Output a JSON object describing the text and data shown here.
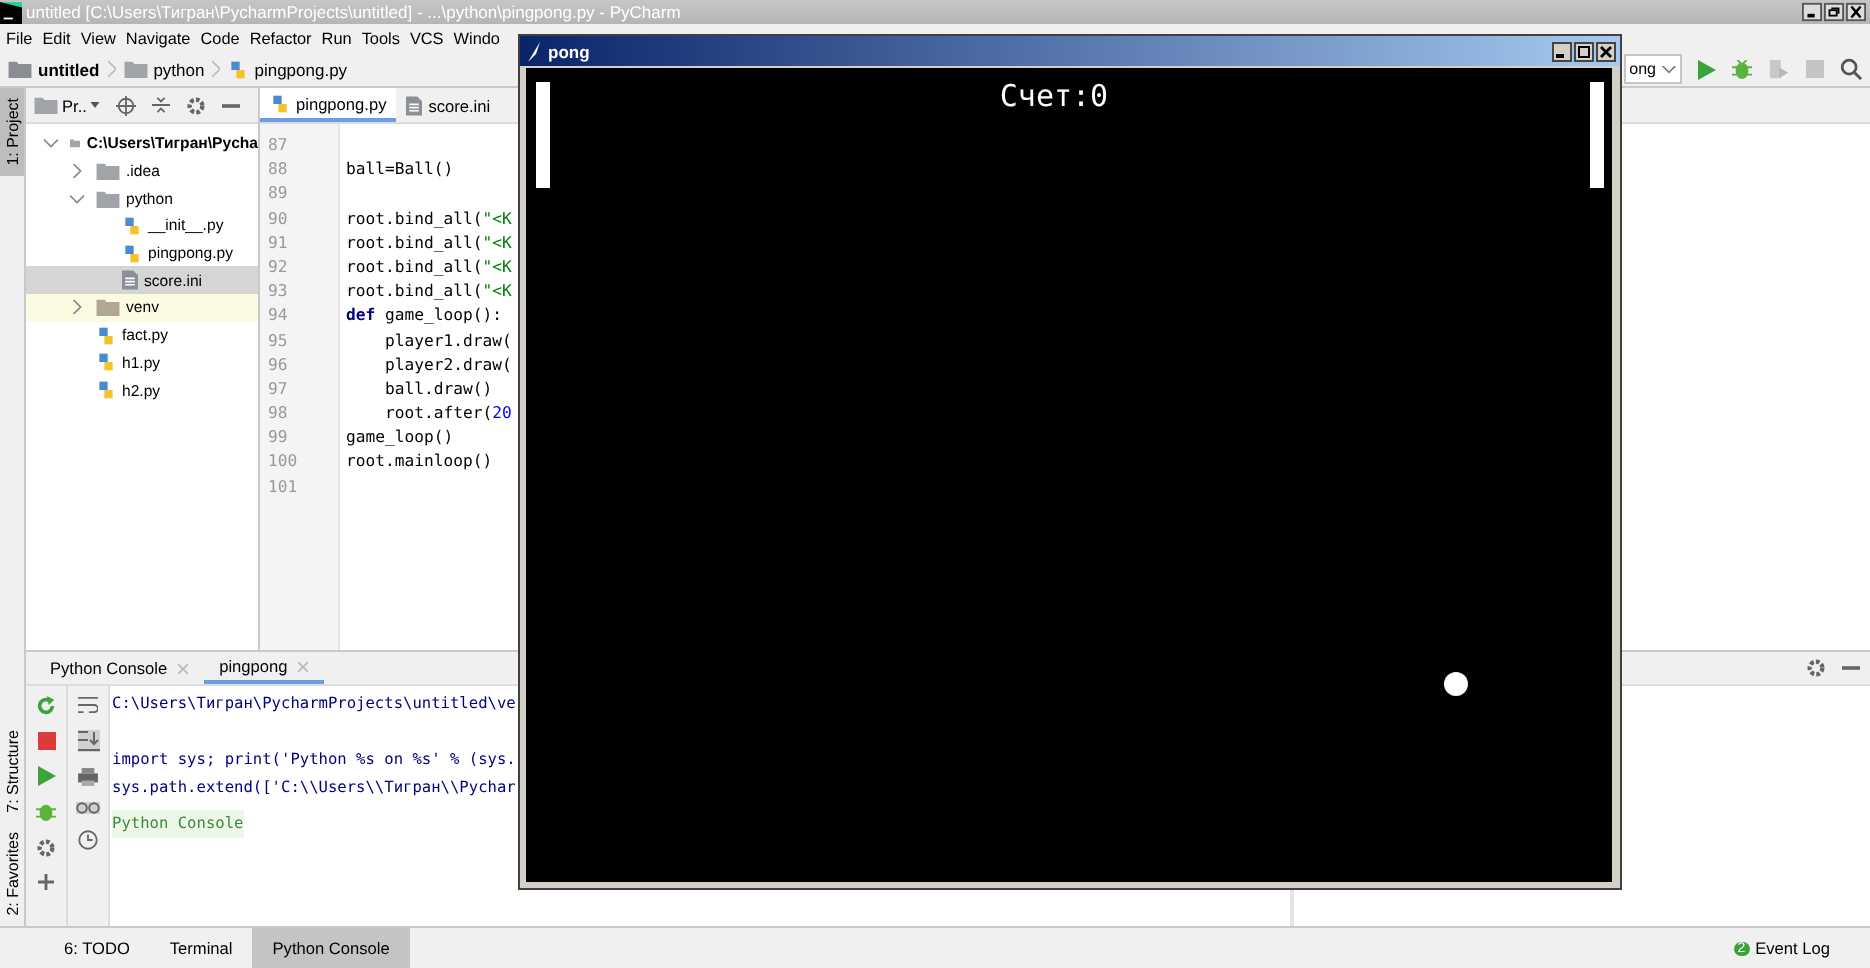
{
  "window": {
    "title": "untitled [C:\\Users\\Тигран\\PycharmProjects\\untitled] - ...\\python\\pingpong.py - PyCharm"
  },
  "menu": [
    "File",
    "Edit",
    "View",
    "Navigate",
    "Code",
    "Refactor",
    "Run",
    "Tools",
    "VCS",
    "Windo"
  ],
  "breadcrumbs": [
    {
      "label": "untitled",
      "kind": "project"
    },
    {
      "label": "python",
      "kind": "folder"
    },
    {
      "label": "pingpong.py",
      "kind": "python"
    }
  ],
  "run_config": {
    "label": "ong"
  },
  "left_stripe_top": [
    {
      "label": "1: Project",
      "selected": true
    }
  ],
  "left_stripe_bottom": [
    {
      "label": "7: Structure",
      "selected": false
    },
    {
      "label": "2: Favorites",
      "selected": false
    }
  ],
  "project_panel": {
    "title": "Pr.."
  },
  "tree": [
    {
      "label": "C:\\Users\\Тигран\\Pycha",
      "kind": "folder",
      "expanded": true,
      "selected": false,
      "children": [
        {
          "label": ".idea",
          "kind": "folder",
          "expanded": false,
          "selected": false
        },
        {
          "label": "python",
          "kind": "folder",
          "expanded": true,
          "selected": false,
          "children": [
            {
              "label": "__init__.py",
              "kind": "python",
              "selected": false
            },
            {
              "label": "pingpong.py",
              "kind": "python",
              "selected": false
            },
            {
              "label": "score.ini",
              "kind": "ini",
              "selected": true
            }
          ]
        },
        {
          "label": "venv",
          "kind": "excluded_folder",
          "expanded": false,
          "selected": false
        },
        {
          "label": "fact.py",
          "kind": "python",
          "selected": false
        },
        {
          "label": "h1.py",
          "kind": "python",
          "selected": false
        },
        {
          "label": "h2.py",
          "kind": "python",
          "selected": false
        }
      ]
    }
  ],
  "editor": {
    "tabs": [
      {
        "label": "pingpong.py",
        "kind": "python",
        "selected": true
      },
      {
        "label": "score.ini",
        "kind": "ini",
        "selected": false
      }
    ],
    "lines": [
      {
        "number": "87"
      },
      {
        "number": "88",
        "tokens": [
          {
            "text": "ball=Ball()",
            "kind": "plain"
          }
        ]
      },
      {
        "number": "89"
      },
      {
        "number": "90",
        "tokens": [
          {
            "text": "root.bind_all(",
            "kind": "plain"
          },
          {
            "text": "\"<K",
            "kind": "string"
          }
        ]
      },
      {
        "number": "91",
        "tokens": [
          {
            "text": "root.bind_all(",
            "kind": "plain"
          },
          {
            "text": "\"<K",
            "kind": "string"
          }
        ]
      },
      {
        "number": "92",
        "tokens": [
          {
            "text": "root.bind_all(",
            "kind": "plain"
          },
          {
            "text": "\"<K",
            "kind": "string"
          }
        ]
      },
      {
        "number": "93",
        "tokens": [
          {
            "text": "root.bind_all(",
            "kind": "plain"
          },
          {
            "text": "\"<K",
            "kind": "string"
          }
        ]
      },
      {
        "number": "94",
        "tokens": [
          {
            "text": "def",
            "kind": "keyword"
          },
          {
            "text": " game_loop():",
            "kind": "plain"
          }
        ]
      },
      {
        "number": "95",
        "tokens": [
          {
            "text": "    player1.draw(",
            "kind": "plain"
          }
        ]
      },
      {
        "number": "96",
        "tokens": [
          {
            "text": "    player2.draw(",
            "kind": "plain"
          }
        ]
      },
      {
        "number": "97",
        "tokens": [
          {
            "text": "    ball.draw()",
            "kind": "plain"
          }
        ]
      },
      {
        "number": "98",
        "tokens": [
          {
            "text": "    root.after(",
            "kind": "plain"
          },
          {
            "text": "20",
            "kind": "number"
          }
        ]
      },
      {
        "number": "99",
        "tokens": [
          {
            "text": "game_loop()",
            "kind": "plain"
          }
        ]
      },
      {
        "number": "100",
        "tokens": [
          {
            "text": "root.mainloop()",
            "kind": "plain"
          }
        ]
      },
      {
        "number": "101"
      }
    ]
  },
  "console": {
    "tabs": [
      {
        "label": "Python Console",
        "selected": false
      },
      {
        "label": "pingpong",
        "selected": true
      }
    ],
    "lines": [
      {
        "text": "C:\\Users\\Тигран\\PycharmProjects\\untitled\\ve",
        "kind": "output"
      },
      {
        "text": "import sys; print('Python %s on %s' % (sys.",
        "kind": "output"
      },
      {
        "text": "sys.path.extend(['C:\\\\Users\\\\Тигран\\\\Pychar",
        "kind": "output"
      },
      {
        "text": "Python Console",
        "kind": "prompt"
      }
    ]
  },
  "status_tabs": [
    {
      "label": "6: TODO",
      "selected": false
    },
    {
      "label": "Terminal",
      "selected": false
    },
    {
      "label": "Python Console",
      "selected": true
    }
  ],
  "event_log": {
    "label": "Event Log",
    "count": "2"
  },
  "pong": {
    "title": "pong",
    "score": "Счет:0"
  }
}
